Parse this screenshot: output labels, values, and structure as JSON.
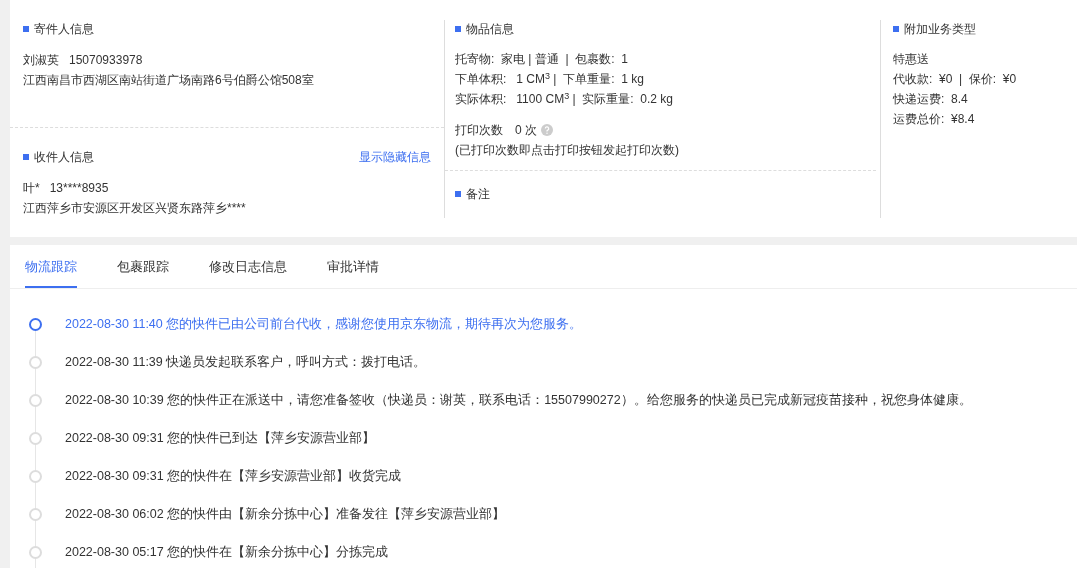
{
  "sender": {
    "title": "寄件人信息",
    "name": "刘淑英",
    "phone": "15070933978",
    "address": "江西南昌市西湖区南站街道广场南路6号伯爵公馆508室"
  },
  "recipient": {
    "title": "收件人信息",
    "link": "显示隐藏信息",
    "name": "叶*",
    "phone": "13****8935",
    "address": "江西萍乡市安源区开发区兴贤东路萍乡****"
  },
  "goods": {
    "title": "物品信息",
    "lines": [
      "托寄物:  家电 | 普通  |  包裹数:  1",
      "下单体积:   1 CM$^{3}$ |  下单重量:  1 kg",
      "实际体积:   1100 CM$^{3}$ |  实际重量:  0.2 kg"
    ],
    "print_label": "打印次数",
    "print_count": "0 次",
    "print_note": "(已打印次数即点击打印按钮发起打印次数)"
  },
  "remark": {
    "title": "备注"
  },
  "extra": {
    "title": "附加业务类型",
    "lines": [
      "特惠送",
      "代收款:  ¥0  |  保价:  ¥0",
      "快递运费:  8.4",
      "运费总价:  ¥8.4"
    ]
  },
  "tabs": [
    {
      "label": "物流跟踪",
      "selected": true
    },
    {
      "label": "包裹跟踪",
      "selected": false
    },
    {
      "label": "修改日志信息",
      "selected": false
    },
    {
      "label": "审批详情",
      "selected": false
    }
  ],
  "timeline": [
    {
      "text": "2022-08-30 11:40 您的快件已由公司前台代收，感谢您使用京东物流，期待再次为您服务。",
      "current": true
    },
    {
      "text": "2022-08-30 11:39 快递员发起联系客户，呼叫方式：拨打电话。",
      "current": false
    },
    {
      "text": "2022-08-30 10:39 您的快件正在派送中，请您准备签收（快递员：谢英，联系电话：15507990272）。给您服务的快递员已完成新冠疫苗接种，祝您身体健康。",
      "current": false
    },
    {
      "text": "2022-08-30 09:31 您的快件已到达【萍乡安源营业部】",
      "current": false
    },
    {
      "text": "2022-08-30 09:31 您的快件在【萍乡安源营业部】收货完成",
      "current": false
    },
    {
      "text": "2022-08-30 06:02 您的快件由【新余分拣中心】准备发往【萍乡安源营业部】",
      "current": false
    },
    {
      "text": "2022-08-30 05:17 您的快件在【新余分拣中心】分拣完成",
      "current": false
    }
  ]
}
